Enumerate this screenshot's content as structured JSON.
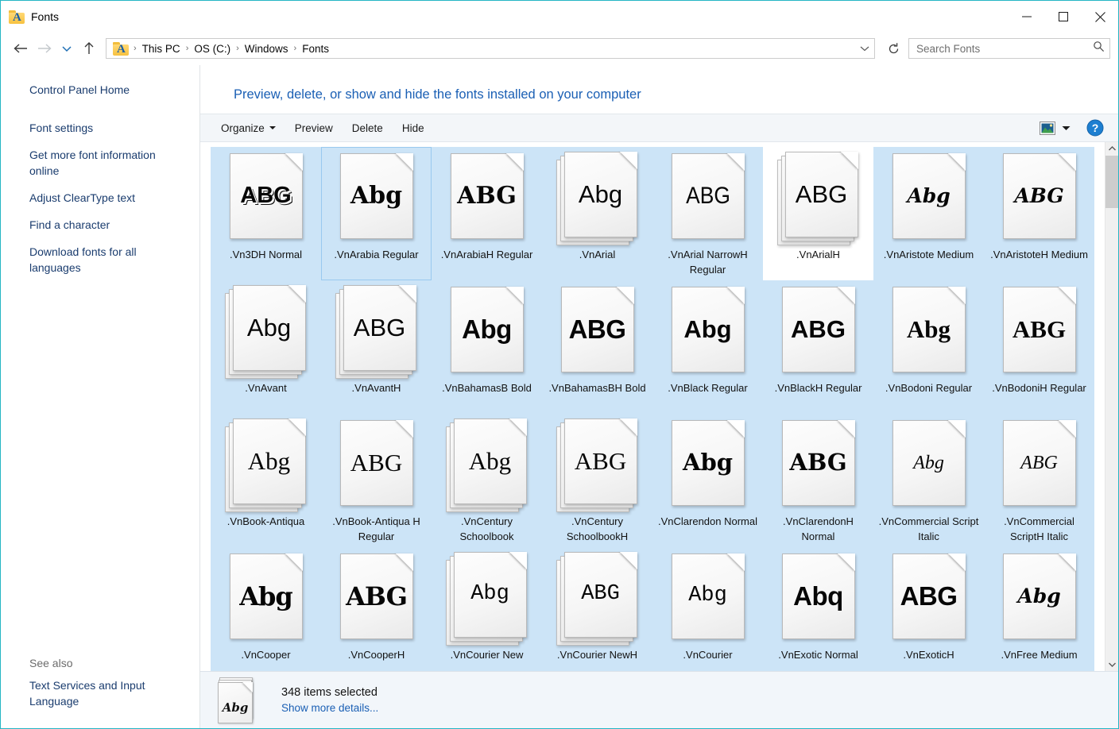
{
  "window": {
    "title": "Fonts",
    "folder_icon": "fonts-folder-icon",
    "minimize_label": "Minimize",
    "maximize_label": "Maximize",
    "close_label": "Close"
  },
  "navigation": {
    "back_label": "Back",
    "forward_label": "Forward",
    "recent_label": "Recent locations",
    "up_label": "Up",
    "refresh_label": "Refresh",
    "breadcrumb": [
      "This PC",
      "OS (C:)",
      "Windows",
      "Fonts"
    ],
    "separator": "›"
  },
  "search": {
    "placeholder": "Search Fonts",
    "value": "",
    "icon": "search-icon"
  },
  "sidebar": {
    "home_link": "Control Panel Home",
    "links": [
      "Font settings",
      "Get more font information online",
      "Adjust ClearType text",
      "Find a character",
      "Download fonts for all languages"
    ],
    "see_also_title": "See also",
    "see_also_links": [
      "Text Services and Input Language"
    ]
  },
  "main": {
    "heading": "Preview, delete, or show and hide the fonts installed on your computer",
    "commands": [
      {
        "label": "Organize",
        "has_caret": true
      },
      {
        "label": "Preview",
        "has_caret": false
      },
      {
        "label": "Delete",
        "has_caret": false
      },
      {
        "label": "Hide",
        "has_caret": false
      }
    ],
    "view_icon": "view-options-icon",
    "view_caret": "chevron-down-icon",
    "help_icon": "help-icon",
    "help_label": "?"
  },
  "fonts": [
    {
      "name": ".Vn3DH Normal",
      "glyph": "ABG",
      "style": "g-3d",
      "stacked": false,
      "selected": true,
      "focused": false
    },
    {
      "name": ".VnArabia Regular",
      "glyph": "Abg",
      "style": "g-deco",
      "stacked": false,
      "selected": true,
      "focused": true
    },
    {
      "name": ".VnArabiaH Regular",
      "glyph": "ABG",
      "style": "g-deco",
      "stacked": false,
      "selected": true,
      "focused": false
    },
    {
      "name": ".VnArial",
      "glyph": "Abg",
      "style": "g-sans",
      "stacked": true,
      "selected": true,
      "focused": false
    },
    {
      "name": ".VnArial NarrowH Regular",
      "glyph": "ABG",
      "style": "g-narrow",
      "stacked": false,
      "selected": true,
      "focused": false
    },
    {
      "name": ".VnArialH",
      "glyph": "ABG",
      "style": "g-sans",
      "stacked": true,
      "selected": false,
      "focused": false
    },
    {
      "name": ".VnAristote Medium",
      "glyph": "Abg",
      "style": "g-script",
      "stacked": false,
      "selected": true,
      "focused": false
    },
    {
      "name": ".VnAristoteH Medium",
      "glyph": "ABG",
      "style": "g-script",
      "stacked": false,
      "selected": true,
      "focused": false
    },
    {
      "name": ".VnAvant",
      "glyph": "Abg",
      "style": "g-sans",
      "stacked": true,
      "selected": true,
      "focused": false
    },
    {
      "name": ".VnAvantH",
      "glyph": "ABG",
      "style": "g-sans",
      "stacked": true,
      "selected": true,
      "focused": false
    },
    {
      "name": ".VnBahamasB Bold",
      "glyph": "Abg",
      "style": "g-sans-hb",
      "stacked": false,
      "selected": true,
      "focused": false
    },
    {
      "name": ".VnBahamasBH Bold",
      "glyph": "ABG",
      "style": "g-sans-hb",
      "stacked": false,
      "selected": true,
      "focused": false
    },
    {
      "name": ".VnBlack Regular",
      "glyph": "Abg",
      "style": "g-sans-b",
      "stacked": false,
      "selected": true,
      "focused": false
    },
    {
      "name": ".VnBlackH Regular",
      "glyph": "ABG",
      "style": "g-sans-b",
      "stacked": false,
      "selected": true,
      "focused": false
    },
    {
      "name": ".VnBodoni Regular",
      "glyph": "Abg",
      "style": "g-serif-b",
      "stacked": false,
      "selected": true,
      "focused": false
    },
    {
      "name": ".VnBodoniH Regular",
      "glyph": "ABG",
      "style": "g-serif-b",
      "stacked": false,
      "selected": true,
      "focused": false
    },
    {
      "name": ".VnBook-Antiqua",
      "glyph": "Abg",
      "style": "g-serif",
      "stacked": true,
      "selected": true,
      "focused": false
    },
    {
      "name": ".VnBook-Antiqua H Regular",
      "glyph": "ABG",
      "style": "g-serif",
      "stacked": false,
      "selected": true,
      "focused": false
    },
    {
      "name": ".VnCentury Schoolbook",
      "glyph": "Abg",
      "style": "g-serif",
      "stacked": true,
      "selected": true,
      "focused": false
    },
    {
      "name": ".VnCentury SchoolbookH",
      "glyph": "ABG",
      "style": "g-serif",
      "stacked": true,
      "selected": true,
      "focused": false
    },
    {
      "name": ".VnClarendon Normal",
      "glyph": "Abg",
      "style": "g-slab",
      "stacked": false,
      "selected": true,
      "focused": false
    },
    {
      "name": ".VnClarendonH Normal",
      "glyph": "ABG",
      "style": "g-slab",
      "stacked": false,
      "selected": true,
      "focused": false
    },
    {
      "name": ".VnCommercial Script Italic",
      "glyph": "Abg",
      "style": "g-script-l",
      "stacked": false,
      "selected": true,
      "focused": false
    },
    {
      "name": ".VnCommercial ScriptH Italic",
      "glyph": "ABG",
      "style": "g-script-l",
      "stacked": false,
      "selected": true,
      "focused": false
    },
    {
      "name": ".VnCooper",
      "glyph": "Abg",
      "style": "g-fat",
      "stacked": false,
      "selected": true,
      "focused": false
    },
    {
      "name": ".VnCooperH",
      "glyph": "ABG",
      "style": "g-fat",
      "stacked": false,
      "selected": true,
      "focused": false
    },
    {
      "name": ".VnCourier New",
      "glyph": "Abg",
      "style": "g-mono",
      "stacked": true,
      "selected": true,
      "focused": false
    },
    {
      "name": ".VnCourier NewH",
      "glyph": "ABG",
      "style": "g-mono",
      "stacked": true,
      "selected": true,
      "focused": false
    },
    {
      "name": ".VnCourier",
      "glyph": "Abg",
      "style": "g-mono",
      "stacked": false,
      "selected": true,
      "focused": false
    },
    {
      "name": ".VnExotic Normal",
      "glyph": "Abq",
      "style": "g-sans-hb",
      "stacked": false,
      "selected": true,
      "focused": false
    },
    {
      "name": ".VnExoticH",
      "glyph": "ABG",
      "style": "g-sans-hb",
      "stacked": false,
      "selected": true,
      "focused": false
    },
    {
      "name": ".VnFree Medium",
      "glyph": "Abg",
      "style": "g-script",
      "stacked": false,
      "selected": true,
      "focused": false
    }
  ],
  "statusbar": {
    "count_text": "348 items selected",
    "details_link": "Show more details...",
    "icon": "font-file-stack-icon",
    "icon_glyph": "Abg"
  },
  "scrollbar": {
    "up_label": "Scroll up",
    "down_label": "Scroll down",
    "thumb_label": "Vertical scroll thumb"
  },
  "colors": {
    "window_border": "#24b6c4",
    "selection": "#cce4f7",
    "heading_blue": "#1a5fb4",
    "link_blue": "#1a3c6e",
    "cmdbar_bg": "#f3f6f9",
    "statusbar_bg": "#f2f6fa"
  }
}
